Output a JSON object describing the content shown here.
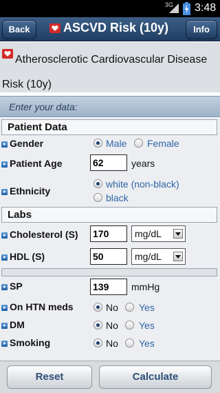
{
  "status_bar": {
    "network": "3G",
    "time": "3:48"
  },
  "header": {
    "back_label": "Back",
    "title": "ASCVD Risk (10y)",
    "info_label": "Info"
  },
  "banner": {
    "text": "Atherosclerotic Cardiovascular Disease Risk (10y)"
  },
  "form_intro": "Enter your data:",
  "patient_data": {
    "section_title": "Patient Data",
    "gender": {
      "label": "Gender",
      "options": [
        "Male",
        "Female"
      ],
      "selected": "Male"
    },
    "age": {
      "label": "Patient Age",
      "value": "62",
      "unit": "years"
    },
    "ethnicity": {
      "label": "Ethnicity",
      "options": [
        "white (non-black)",
        "black"
      ],
      "selected": "white (non-black)"
    }
  },
  "labs": {
    "section_title": "Labs",
    "cholesterol": {
      "label": "Cholesterol (S)",
      "value": "170",
      "unit": "mg/dL"
    },
    "hdl": {
      "label": "HDL (S)",
      "value": "50",
      "unit": "mg/dL"
    }
  },
  "vitals": {
    "sp": {
      "label": "SP",
      "value": "139",
      "unit": "mmHg"
    },
    "htn_meds": {
      "label": "On HTN meds",
      "options": [
        "No",
        "Yes"
      ],
      "selected": "No"
    },
    "dm": {
      "label": "DM",
      "options": [
        "No",
        "Yes"
      ],
      "selected": "No"
    },
    "smoking": {
      "label": "Smoking",
      "options": [
        "No",
        "Yes"
      ],
      "selected": "No"
    }
  },
  "footer": {
    "reset_label": "Reset",
    "calculate_label": "Calculate"
  },
  "colors": {
    "header": "#2b4b73",
    "accent": "#2f66a6",
    "heart": "#d42a2a"
  }
}
